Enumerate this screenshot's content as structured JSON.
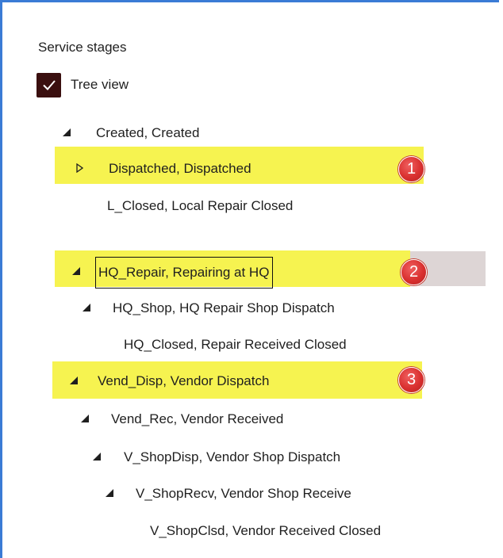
{
  "panel": {
    "section_title": "Service stages",
    "tree_view": {
      "label": "Tree view",
      "checked": true
    }
  },
  "tree": [
    {
      "label": "Created, Created",
      "state": "expanded"
    },
    {
      "label": "Dispatched, Dispatched",
      "state": "collapsed",
      "badge": "1",
      "highlight": "yellow"
    },
    {
      "label": "L_Closed, Local Repair Closed",
      "state": "leaf"
    },
    {
      "label": "HQ_Repair, Repairing at HQ",
      "state": "expanded",
      "badge": "2",
      "highlight": "yellow",
      "selected": true
    },
    {
      "label": "HQ_Shop, HQ Repair Shop Dispatch",
      "state": "expanded"
    },
    {
      "label": "HQ_Closed, Repair Received Closed",
      "state": "leaf"
    },
    {
      "label": "Vend_Disp, Vendor Dispatch",
      "state": "expanded",
      "badge": "3",
      "highlight": "yellow"
    },
    {
      "label": "Vend_Rec, Vendor Received",
      "state": "expanded"
    },
    {
      "label": "V_ShopDisp, Vendor Shop Dispatch",
      "state": "expanded"
    },
    {
      "label": "V_ShopRecv, Vendor Shop Receive",
      "state": "expanded"
    },
    {
      "label": "V_ShopClsd, Vendor Received Closed",
      "state": "leaf"
    }
  ],
  "colors": {
    "highlight": "#f6f350",
    "selection": "#ddd5d5",
    "badge": "#d9302f",
    "checkbox": "#3a0f0f",
    "frame": "#3a7bd5"
  }
}
